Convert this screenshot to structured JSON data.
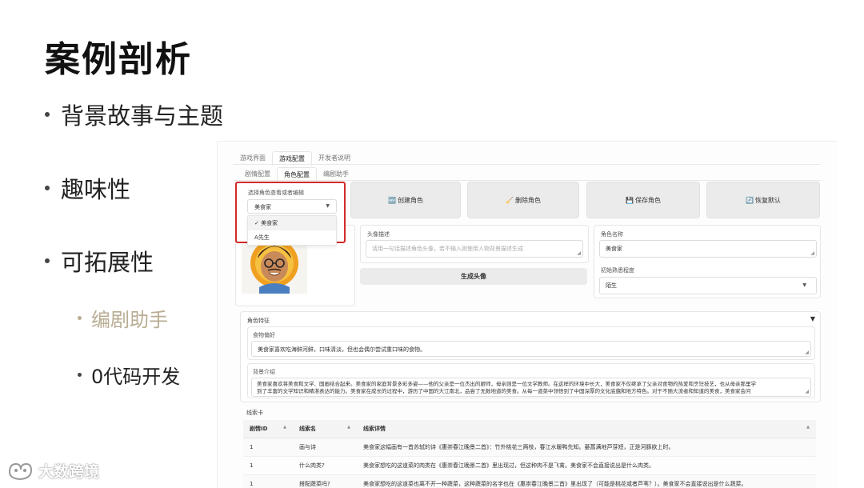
{
  "slide": {
    "title": "案例剖析",
    "bullets": [
      {
        "text": "背景故事与主题"
      },
      {
        "text": "趣味性"
      },
      {
        "text": "可拓展性"
      }
    ],
    "sub_bullets": [
      {
        "text": "编剧助手"
      },
      {
        "text": "0代码开发"
      }
    ]
  },
  "app": {
    "main_tabs": [
      "游戏界面",
      "游戏配置",
      "开发者说明"
    ],
    "active_main_tab": "游戏配置",
    "sub_tabs": [
      "剧情配置",
      "角色配置",
      "编剧助手"
    ],
    "active_sub_tab": "角色配置",
    "character_selector": {
      "label": "选择角色查看或者编辑",
      "value": "美食家",
      "options": [
        "✓ 美食家",
        "A先生"
      ]
    },
    "actions": [
      {
        "icon": "🆕",
        "label": "创建角色"
      },
      {
        "icon": "🧹",
        "label": "删除角色"
      },
      {
        "icon": "💾",
        "label": "保存角色"
      },
      {
        "icon": "🔄",
        "label": "恢复默认"
      }
    ],
    "avatar_desc": {
      "label": "头像描述",
      "placeholder": "请用一句话描述角色头像，若不输入则使用人物背景描述生成"
    },
    "generate_avatar_label": "生成头像",
    "role_name": {
      "label": "角色名称",
      "value": "美食家"
    },
    "familiarity": {
      "label": "初始熟悉程度",
      "value": "陌生"
    },
    "traits_section": "角色特征",
    "food_pref": {
      "label": "食物偏好",
      "value": "美食家喜欢吃海鲜河鲜，口味清淡，但也会偶尔尝试重口味的食物。"
    },
    "background": {
      "label": "背景介绍",
      "line1": "美食家喜欢将美食和文学、国画结合起来。美食家的家庭背景多彩多姿——他的父亲是一位杰出的厨师，母亲则是一位文学教师。在这样的环境中长大，美食家不仅继承了父亲对食物的热爱和烹饪技艺，也从母亲那里学",
      "line2": "到了丰富的文学知识和精湛表达的能力。美食家在成长的过程中，游历了中国的大江南北，品尝了无数地道的美食。从每一道菜中领悟到了中国深厚的文化底蕴和地方特色。对于不随大流者和知道的美食，美食家会问"
    },
    "clue_section": "线索卡",
    "clue_table": {
      "headers": [
        "剧情ID",
        "线索名",
        "线索详情"
      ],
      "rows": [
        [
          "1",
          "画与诗",
          "美食家这幅画有一首苏轼的诗《惠崇春江晚景二首》：竹外桃花三两枝，春江水暖鸭先知。蒌蒿满地芦芽短，正是河豚欲上时。"
        ],
        [
          "1",
          "什么肉类?",
          "美食家想吃的这道菜的肉类在《惠崇春江晚景二首》里出现过，但这种肉不是飞禽。美食家不会直接说出是什么肉类。"
        ],
        [
          "1",
          "搭配蔬菜吗?",
          "美食家想吃的这道菜也离不开一种蔬菜，这种蔬菜的名字也在《惠崇春江晚景二首》里出现了（可能是桃花或者芦苇？）。美食家不会直接说出是什么蔬菜。"
        ]
      ]
    }
  },
  "watermark": "大数跨境",
  "colors": {
    "highlight_border": "#d42a2a",
    "muted_bullet": "#b9ad94"
  }
}
